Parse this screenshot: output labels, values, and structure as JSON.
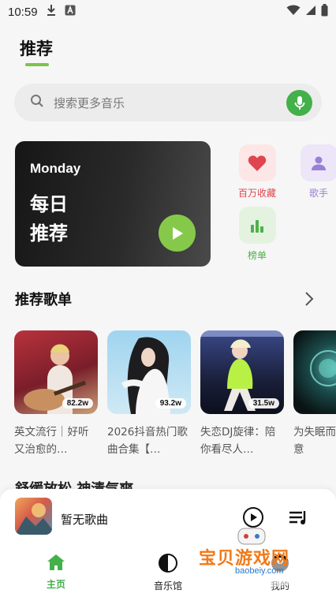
{
  "status_bar": {
    "time": "10:59",
    "left_icons": [
      "download-icon",
      "a-letter-icon"
    ],
    "right_icons": [
      "wifi-icon",
      "signal-icon",
      "battery-icon"
    ]
  },
  "header": {
    "tab_label": "推荐",
    "accent_color": "#7cc24c"
  },
  "search": {
    "placeholder": "搜索更多音乐",
    "mic_color": "#43b04a"
  },
  "daily_card": {
    "day": "Monday",
    "title": "每日推荐"
  },
  "quick_entries": [
    {
      "label": "百万收藏",
      "icon": "heart-icon",
      "color": "#e0454f"
    },
    {
      "label": "歌手",
      "icon": "person-icon",
      "color": "#9b7fd6"
    },
    {
      "label": "榜单",
      "icon": "chart-icon",
      "color": "#4fb04a"
    }
  ],
  "section_recommended": {
    "title": "推荐歌单"
  },
  "playlists": [
    {
      "count": "82.2w",
      "name": "英文流行｜好听又治愈的…"
    },
    {
      "count": "93.2w",
      "name": "2026抖音热门歌曲合集【…"
    },
    {
      "count": "31.5w",
      "name": "失恋DJ旋律：陪你看尽人…"
    },
    {
      "count": "",
      "name": "为失眠而收集困意"
    }
  ],
  "section_next": {
    "title": "舒缓放松 神清气爽"
  },
  "now_playing": {
    "title": "暂无歌曲"
  },
  "bottom_nav": [
    {
      "label": "主页",
      "icon": "home-icon",
      "active": true,
      "color": "#43b04a"
    },
    {
      "label": "音乐馆",
      "icon": "music-hall-icon",
      "active": false
    },
    {
      "label": "我的",
      "icon": "profile-icon",
      "active": false
    }
  ],
  "watermark": {
    "text": "宝贝游戏网",
    "url": "baobeiy.com"
  }
}
